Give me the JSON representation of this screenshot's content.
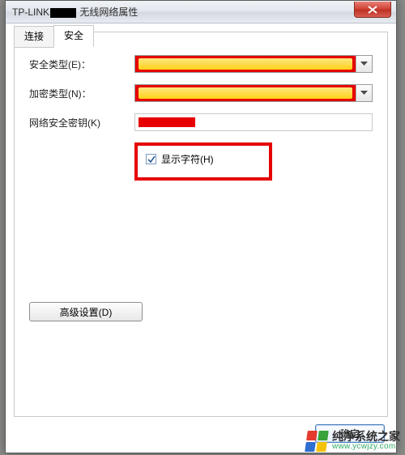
{
  "window": {
    "title_prefix": "TP-LINK",
    "title_suffix": "无线网络属性"
  },
  "tabs": {
    "connection": "连接",
    "security": "安全"
  },
  "form": {
    "security_type_label": "安全类型(E)：",
    "encryption_type_label": "加密类型(N)：",
    "network_key_label": "网络安全密钥(K)",
    "show_chars_label": "显示字符(H)",
    "show_chars_checked": true
  },
  "buttons": {
    "advanced": "高级设置(D)",
    "ok": "确定"
  },
  "watermark": {
    "name": "纯净系统之家",
    "url": "www.ycwjzy.com",
    "colors": [
      "#e43b2e",
      "#3aa23a",
      "#2f6fd1",
      "#f4c20d"
    ]
  }
}
